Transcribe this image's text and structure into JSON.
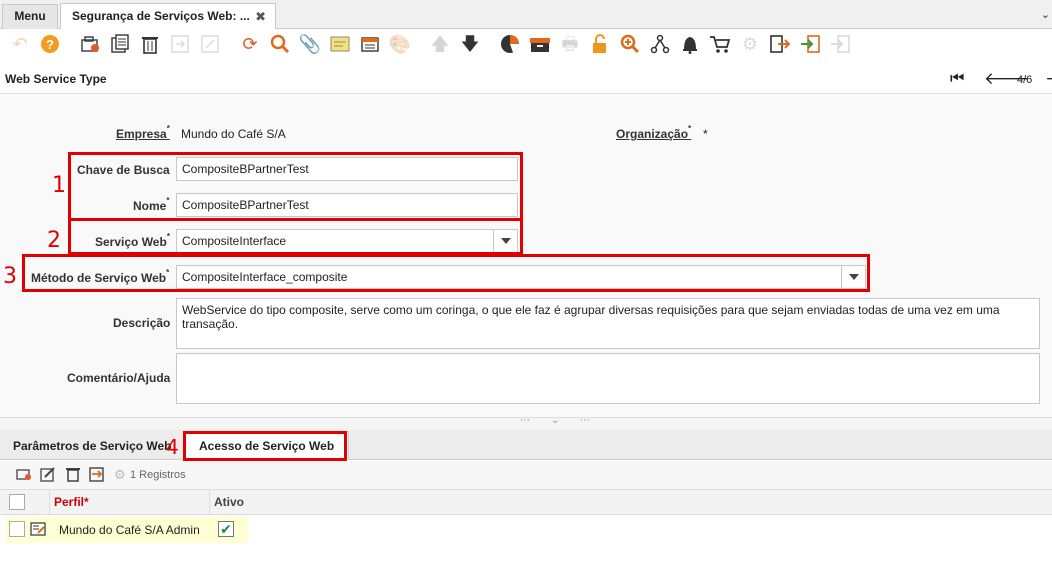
{
  "tabs": {
    "menu_label": "Menu",
    "window_label": "Segurança de Serviços Web: ...",
    "close_glyph": "✖"
  },
  "toolbar": {
    "icons": [
      "undo-icon",
      "help-icon",
      "new-record-icon",
      "copy-record-icon",
      "delete-icon",
      "save-icon",
      "save-new-icon",
      "refresh-icon",
      "find-icon",
      "attachment-icon",
      "note-icon",
      "grid-toggle-icon",
      "customize-icon",
      "parent-record-icon",
      "detail-record-icon",
      "report-icon",
      "archive-icon",
      "print-icon",
      "lock-icon",
      "zoom-across-icon",
      "workflow-icon",
      "alert-icon",
      "request-icon",
      "process-icon",
      "export-icon",
      "import-icon",
      "exit-icon"
    ]
  },
  "header": {
    "title": "Web Service Type",
    "record_position": "4/6"
  },
  "form": {
    "empresa_label": "Empresa",
    "empresa_value": "Mundo do Café S/A",
    "organizacao_label": "Organização",
    "organizacao_value": "*",
    "chave_label": "Chave de Busca",
    "chave_value": "CompositeBPartnerTest",
    "nome_label": "Nome",
    "nome_value": "CompositeBPartnerTest",
    "servico_label": "Serviço Web",
    "servico_value": "CompositeInterface",
    "metodo_label": "Método de Serviço Web",
    "metodo_value": "CompositeInterface_composite",
    "descricao_label": "Descrição",
    "descricao_value": "WebService do tipo composite, serve como um coringa, o que ele faz é agrupar diversas requisições para que sejam enviadas todas de uma vez em uma transação.",
    "comentario_label": "Comentário/Ajuda",
    "comentario_value": "",
    "mandatory_mark": "*"
  },
  "annotations": {
    "n1": "1",
    "n2": "2",
    "n3": "3",
    "n4": "4"
  },
  "detail_tabs": {
    "tab1": "Parâmetros de Serviço Web",
    "tab2": "Acesso de Serviço Web"
  },
  "grid": {
    "count_label": "1 Registros",
    "col_perfil": "Perfil*",
    "col_ativo": "Ativo",
    "rows": [
      {
        "perfil": "Mundo do Café S/A Admin",
        "ativo": true
      }
    ]
  },
  "colors": {
    "annotation_red": "#e00000",
    "mandatory_header_red": "#cc0000"
  }
}
